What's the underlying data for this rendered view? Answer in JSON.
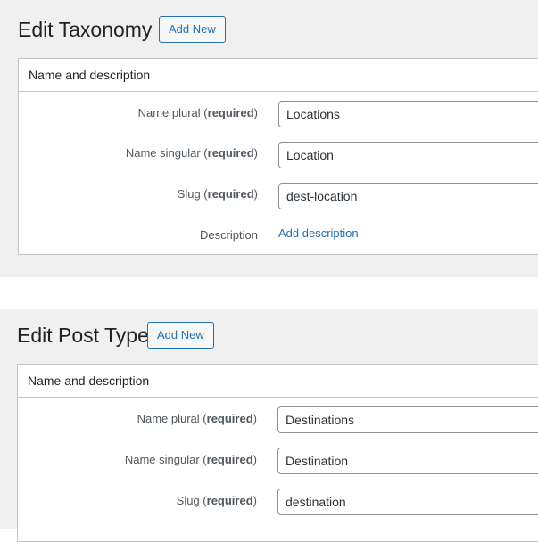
{
  "taxonomy": {
    "title": "Edit Taxonomy",
    "add_new_label": "Add New",
    "box_title": "Name and description",
    "fields": {
      "name_plural": {
        "label": "Name plural",
        "required_text": "required",
        "value": "Locations"
      },
      "name_singular": {
        "label": "Name singular",
        "required_text": "required",
        "value": "Location"
      },
      "slug": {
        "label": "Slug",
        "required_text": "required",
        "value": "dest-location"
      },
      "description": {
        "label": "Description",
        "link": "Add description"
      }
    }
  },
  "post_type": {
    "title": "Edit Post Type",
    "add_new_label": "Add New",
    "box_title": "Name and description",
    "fields": {
      "name_plural": {
        "label": "Name plural",
        "required_text": "required",
        "value": "Destinations"
      },
      "name_singular": {
        "label": "Name singular",
        "required_text": "required",
        "value": "Destination"
      },
      "slug": {
        "label": "Slug",
        "required_text": "required",
        "value": "destination"
      }
    }
  },
  "colors": {
    "accent": "#2271b1",
    "panel_background": "#f0f0f1",
    "border": "#c3c4c7"
  }
}
